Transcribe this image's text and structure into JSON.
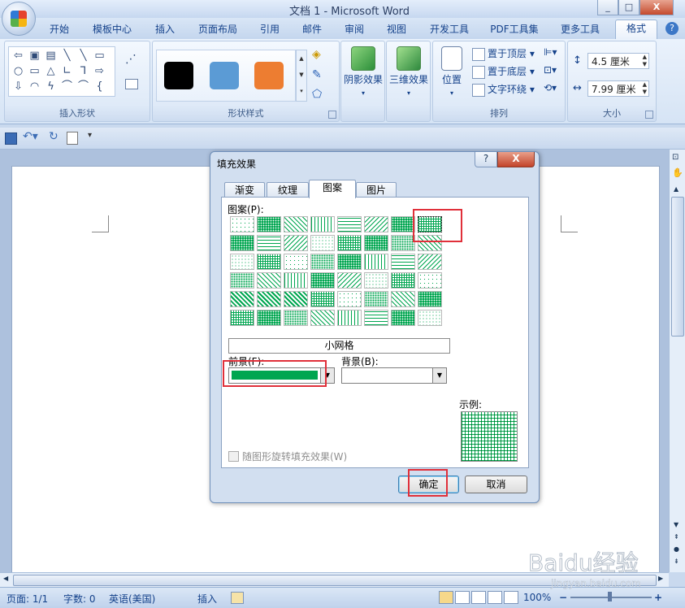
{
  "window": {
    "title": "文档 1 - Microsoft Word",
    "minimize": "_",
    "restore": "□",
    "close": "X"
  },
  "tabs": [
    "开始",
    "模板中心",
    "插入",
    "页面布局",
    "引用",
    "邮件",
    "审阅",
    "视图",
    "开发工具",
    "PDF工具集",
    "更多工具",
    "格式"
  ],
  "active_tab": "格式",
  "help": "?",
  "ribbon": {
    "insert_shapes": {
      "label": "插入形状",
      "shapes": [
        "⇦",
        "▣",
        "▤",
        "╲",
        "╲",
        "▭",
        "○",
        "▭",
        "△",
        "∟",
        "⅂",
        "⇨",
        "⇩",
        "◠",
        "ϟ",
        "⌒",
        "⌒",
        "{"
      ]
    },
    "shape_styles": {
      "label": "形状样式",
      "swatch_colors": [
        "#000000",
        "#5b9bd5",
        "#ed7d31"
      ]
    },
    "shadow": {
      "label": "阴影效果"
    },
    "three_d": {
      "label": "三维效果"
    },
    "arrange": {
      "label": "排列",
      "position": "位置",
      "bring_front": "置于顶层",
      "send_back": "置于底层",
      "text_wrap": "文字环绕"
    },
    "size": {
      "label": "大小",
      "height": "4.5 厘米",
      "width": "7.99 厘米"
    }
  },
  "dialog": {
    "title": "填充效果",
    "help": "?",
    "close": "X",
    "tabs": [
      "渐变",
      "纹理",
      "图案",
      "图片"
    ],
    "active_tab": "图案",
    "pattern_label": "图案(P):",
    "pattern_name": "小网格",
    "foreground_label": "前景(F):",
    "background_label": "背景(B):",
    "foreground_color": "#00a650",
    "example_label": "示例:",
    "rotate_label": "随图形旋转填充效果(W)",
    "ok": "确定",
    "cancel": "取消"
  },
  "status": {
    "page": "页面: 1/1",
    "words": "字数: 0",
    "language": "英语(美国)",
    "insert": "插入",
    "zoom": "100%",
    "zoom_minus": "−",
    "zoom_plus": "+"
  },
  "watermark": {
    "text": "Baidu经验",
    "sub": "jingyan.baidu.com"
  }
}
